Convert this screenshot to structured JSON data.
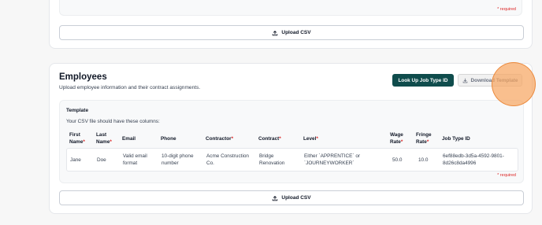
{
  "top_section": {
    "required_note": "* required",
    "upload_label": "Upload CSV"
  },
  "employees": {
    "title": "Employees",
    "subtitle": "Upload employee information and their contract assignments.",
    "lookup_button": "Look Up Job Type ID",
    "download_button": "Download Template",
    "template": {
      "title": "Template",
      "description": "Your CSV file should have these columns:",
      "columns": {
        "first_name": "First Name",
        "last_name": "Last Name",
        "email": "Email",
        "phone": "Phone",
        "contractor": "Contractor",
        "contract": "Contract",
        "level": "Level",
        "wage_rate": "Wage Rate",
        "fringe_rate": "Fringe Rate",
        "job_type_id": "Job Type ID"
      },
      "required_marker": "*",
      "row": {
        "first_name": "Jane",
        "last_name": "Doe",
        "email": "Valid email format",
        "phone": "10-digit phone number",
        "contractor": "Acme Construction Co.",
        "contract": "Bridge Renovation",
        "level": "Either `APPRENTICE` or `JOURNEYWORKER`",
        "wage_rate": "50.0",
        "fringe_rate": "10.0",
        "job_type_id": "6ef88edb-3d5a-4592-9801-8d26c8da4996"
      }
    },
    "required_note": "* required",
    "upload_label": "Upload CSV"
  },
  "colors": {
    "primary_button": "#0f4c4c",
    "required": "#dc2626",
    "cursor_highlight": "#f6a662"
  }
}
